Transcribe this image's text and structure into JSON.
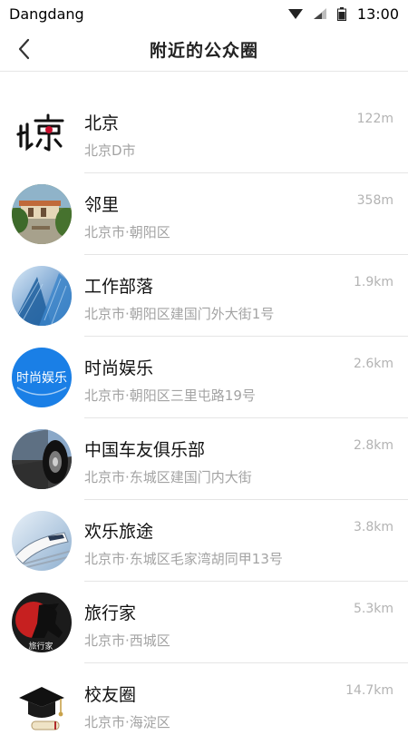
{
  "status": {
    "carrier": "Dangdang",
    "time": "13:00"
  },
  "header": {
    "title": "附近的公众圈",
    "back_icon": "chevron-left-icon"
  },
  "items": [
    {
      "name": "北京",
      "address": "北京D市",
      "distance": "122m"
    },
    {
      "name": "邻里",
      "address": "北京市·朝阳区",
      "distance": "358m"
    },
    {
      "name": "工作部落",
      "address": "北京市·朝阳区建国门外大街1号",
      "distance": "1.9km"
    },
    {
      "name": "时尚娱乐",
      "address": "北京市·朝阳区三里屯路19号",
      "distance": "2.6km"
    },
    {
      "name": "中国车友俱乐部",
      "address": "北京市·东城区建国门内大街",
      "distance": "2.8km"
    },
    {
      "name": "欢乐旅途",
      "address": "北京市·东城区毛家湾胡同甲13号",
      "distance": "3.8km"
    },
    {
      "name": "旅行家",
      "address": "北京市·西城区",
      "distance": "5.3km"
    },
    {
      "name": "校友圈",
      "address": "北京市·海淀区",
      "distance": "14.7km"
    }
  ],
  "avatar_texts": {
    "fashion": "时尚娱乐",
    "travel": "旅行家"
  }
}
